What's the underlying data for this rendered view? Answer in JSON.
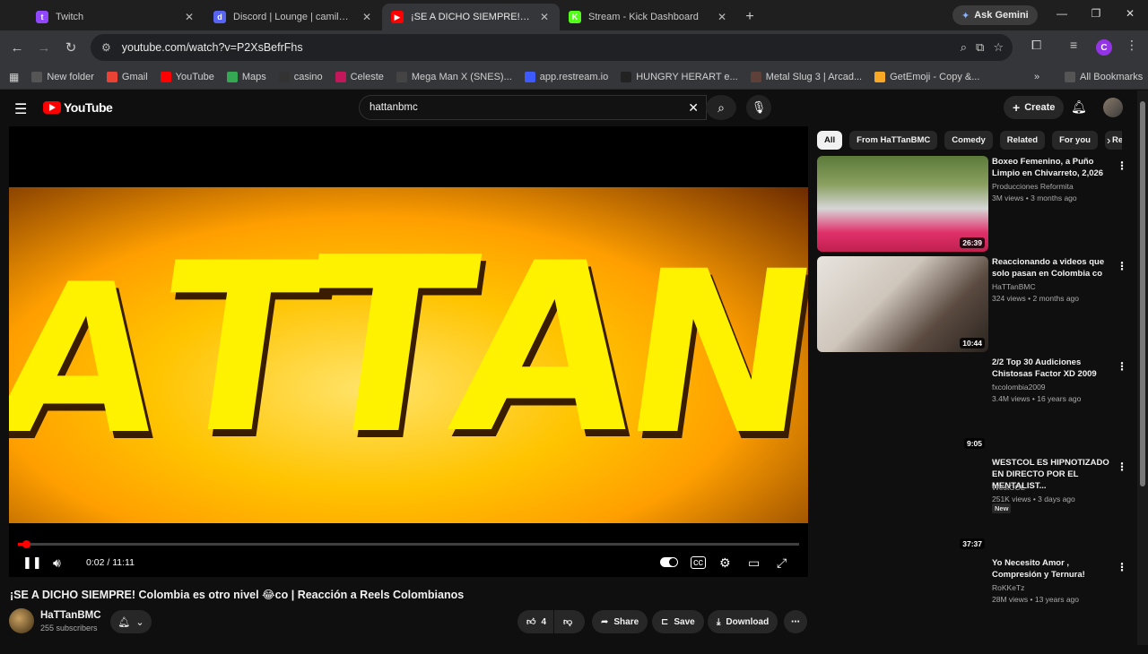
{
  "tabs": [
    {
      "title": "Twitch",
      "color": "#9146ff",
      "glyph": "t",
      "active": false
    },
    {
      "title": "Discord | Lounge | camilosy",
      "color": "#5865f2",
      "glyph": "d",
      "active": false
    },
    {
      "title": "¡SE A DICHO SIEMPRE! Colo",
      "color": "#ff0000",
      "glyph": "▶",
      "active": true
    },
    {
      "title": "Stream - Kick Dashboard",
      "color": "#53fc18",
      "glyph": "K",
      "active": false
    }
  ],
  "gemini_label": "Ask Gemini",
  "url": "youtube.com/watch?v=P2XsBefrFhs",
  "bookmarks": [
    {
      "label": "New folder",
      "color": "#555"
    },
    {
      "label": "Gmail",
      "color": "#ea4335"
    },
    {
      "label": "YouTube",
      "color": "#ff0000"
    },
    {
      "label": "Maps",
      "color": "#34a853"
    },
    {
      "label": "casino",
      "color": "#333"
    },
    {
      "label": "Celeste",
      "color": "#c2185b"
    },
    {
      "label": "Mega Man X (SNES)...",
      "color": "#444"
    },
    {
      "label": "app.restream.io",
      "color": "#3d5afe"
    },
    {
      "label": "HUNGRY HERART e...",
      "color": "#222"
    },
    {
      "label": "Metal Slug 3 | Arcad...",
      "color": "#5d4037"
    },
    {
      "label": "GetEmoji - Copy &...",
      "color": "#f9a825"
    }
  ],
  "all_bookmarks_label": "All Bookmarks",
  "yt": {
    "logo_text": "YouTube",
    "search_value": "hattanbmc",
    "create_label": "Create"
  },
  "player": {
    "time": "0:02 / 11:11",
    "progress": 0.003
  },
  "video": {
    "title": "¡SE A DICHO SIEMPRE! Colombia es otro nivel 😂co | Reacción a Reels Colombianos",
    "channel": "HaTTanBMC",
    "subscribers": "255 subscribers",
    "likes": "4",
    "share_label": "Share",
    "save_label": "Save",
    "download_label": "Download"
  },
  "chips": [
    "All",
    "From HaTTanBMC",
    "Comedy",
    "Related",
    "For you",
    "Re"
  ],
  "recommendations": [
    {
      "title": "Boxeo Femenino, a Puño Limpio en Chivarreto, 2,026",
      "channel": "Producciones Reformita",
      "meta": "3M views • 3 months ago",
      "duration": "26:39",
      "thumb": "boxing"
    },
    {
      "title": "Reaccionando a videos que solo pasan en Colombia co",
      "channel": "HaTTanBMC",
      "meta": "324 views • 2 months ago",
      "duration": "10:44",
      "thumb": "reaction"
    },
    {
      "title": "2/2 Top 30 Audiciones Chistosas Factor XD 2009",
      "channel": "fxcolombia2009",
      "meta": "3.4M views • 16 years ago",
      "duration": "9:05",
      "thumb": "blank"
    },
    {
      "title": "WESTCOL ES HIPNOTIZADO EN DIRECTO POR EL MENTALIST...",
      "channel": "WestCOL",
      "meta": "251K views • 3 days ago",
      "duration": "37:37",
      "thumb": "blank",
      "badge": "New"
    },
    {
      "title": "Yo Necesito Amor , Compresión y Ternura!",
      "channel": "RoKKeTz",
      "meta": "28M views • 13 years ago",
      "duration": "",
      "thumb": "blank"
    }
  ]
}
